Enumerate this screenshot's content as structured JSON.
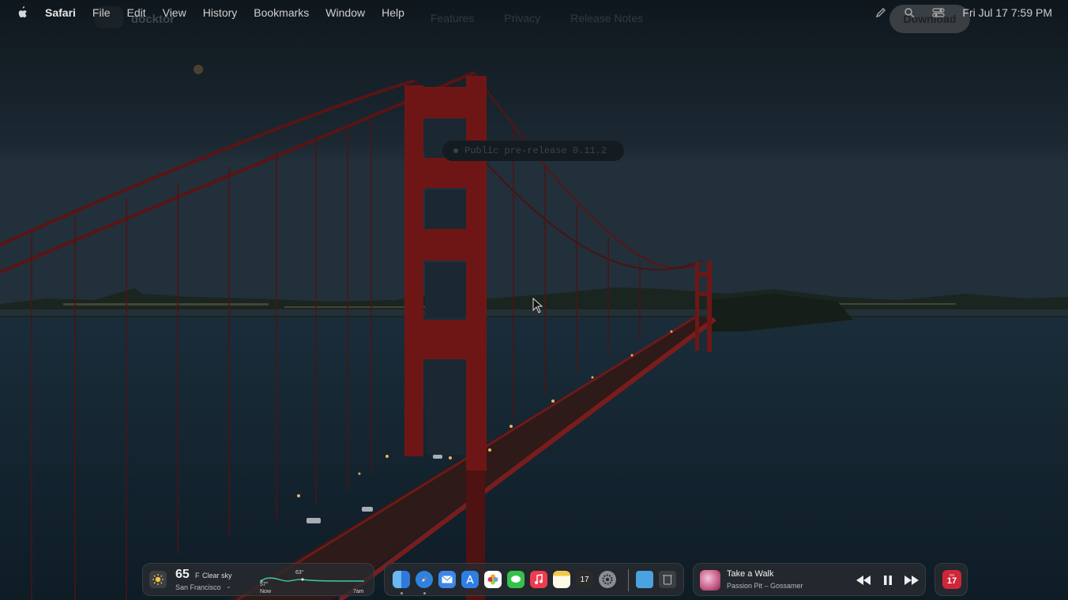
{
  "menubar": {
    "app_name": "Safari",
    "menus": [
      "File",
      "Edit",
      "View",
      "History",
      "Bookmarks",
      "Window",
      "Help"
    ],
    "clock": "Fri Jul 17  7:59 PM"
  },
  "website": {
    "title": "docktor",
    "nav": [
      "Features",
      "Privacy",
      "Release Notes"
    ],
    "download_label": "Download",
    "badge": "Public pre-release 0.11.2"
  },
  "weather": {
    "temperature": "65",
    "unit": "F",
    "condition": "Clear sky",
    "location": "San Francisco",
    "forecast_high": "63°",
    "forecast_now_temp": "57°",
    "label_now": "Now",
    "label_end": "7am"
  },
  "dock": {
    "apps": [
      {
        "name": "Finder",
        "icon": "finder-icon",
        "color": "#2f7ad9",
        "running": true
      },
      {
        "name": "Safari",
        "icon": "safari-icon",
        "color": "#3b8de0",
        "running": true
      },
      {
        "name": "Mail",
        "icon": "mail-icon",
        "color": "#3e86e8",
        "running": false
      },
      {
        "name": "App Store",
        "icon": "app-store-icon",
        "color": "#2d7fe3",
        "running": false
      },
      {
        "name": "Photos",
        "icon": "photos-icon",
        "color": "#e38a2d",
        "running": false
      },
      {
        "name": "Messages",
        "icon": "messages-icon",
        "color": "#35c24b",
        "running": false
      },
      {
        "name": "Music",
        "icon": "music-icon",
        "color": "#f03a4f",
        "running": false
      },
      {
        "name": "Notes",
        "icon": "notes-icon",
        "color": "#f2c94c",
        "running": false
      },
      {
        "name": "Calendar",
        "icon": "calendar-icon",
        "color": "#2a2a2a",
        "running": false,
        "label": "17"
      },
      {
        "name": "System Settings",
        "icon": "settings-icon",
        "color": "#8a8e93",
        "running": false
      },
      {
        "name": "Downloads",
        "icon": "folder-icon",
        "color": "#4aa3e0",
        "running": false
      },
      {
        "name": "Trash",
        "icon": "trash-icon",
        "color": "#3b3f43",
        "running": false
      }
    ]
  },
  "music": {
    "track": "Take a Walk",
    "artist": "Passion Pit – Gossamer"
  },
  "calendar_widget": {
    "day": "FRI",
    "date": "17"
  }
}
